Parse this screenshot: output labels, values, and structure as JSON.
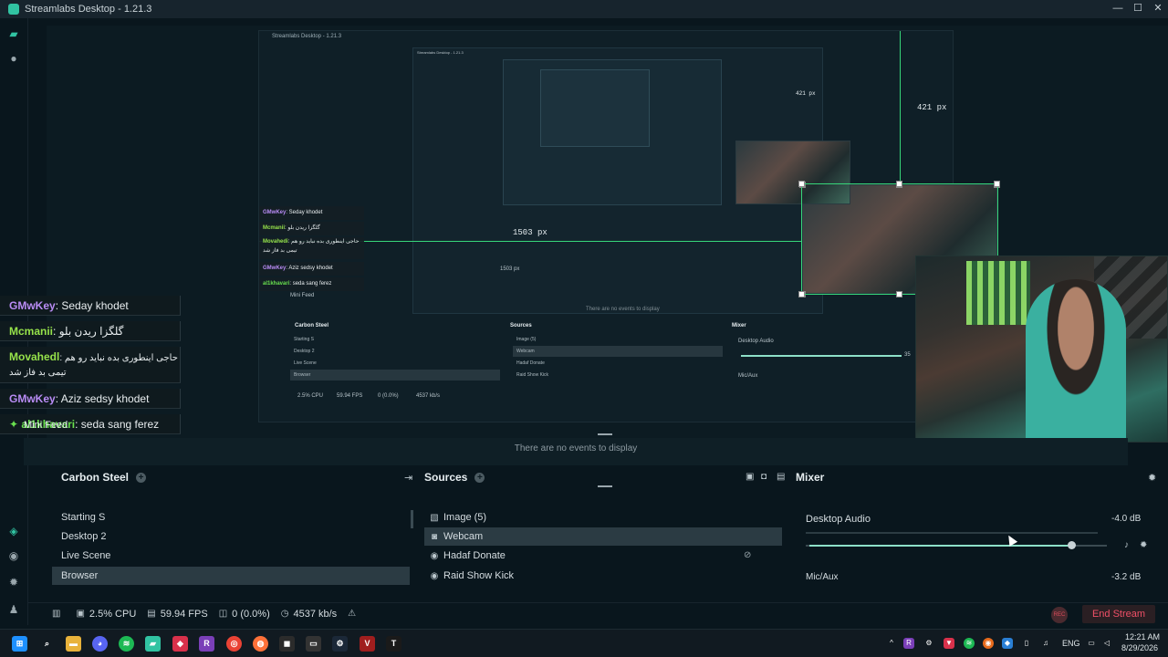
{
  "window": {
    "title": "Streamlabs Desktop - 1.21.3",
    "controls": [
      "—",
      "☐",
      "✕"
    ]
  },
  "nested_preview": {
    "title": "Streamlabs Desktop - 1.21.3",
    "title_inner": "Streamlabs Desktop - 1.21.3",
    "measure_width": "1503 px",
    "measure_height": "421 px",
    "measure_width_small": "1503 px",
    "measure_height_small": "421 px",
    "mini_feed": "Mini Feed",
    "empty": "There are no events to display",
    "scenes_title": "Carbon Steel",
    "scenes": [
      "Starting S",
      "Desktop 2",
      "Live Scene",
      "Browser"
    ],
    "sources_title": "Sources",
    "sources": [
      "Image (5)",
      "Webcam",
      "Hadaf Donate",
      "Raid Show Kick"
    ],
    "mixer_title": "Mixer",
    "mixer": [
      "Desktop Audio",
      "Mic/Aux"
    ],
    "volume_label": "35",
    "status": [
      "2.5% CPU",
      "59.94 FPS",
      "0 (0.0%)",
      "4537 kb/s"
    ],
    "chat": [
      {
        "user": "GMwKey",
        "text": ": Seday khodet",
        "color": "purple"
      },
      {
        "user": "Mcmanii",
        "text": ": گلگزا ریدن بلو",
        "color": "green"
      },
      {
        "user": "Movahedi",
        "text": ": حاجی اینطوری بده نباید رو هم تیمی بد فاز شد",
        "color": "green"
      },
      {
        "user": "GMwKey",
        "text": ": Aziz sedsy khodet",
        "color": "purple"
      },
      {
        "user": "al1khavari",
        "text": ": seda sang ferez",
        "color": "green2"
      }
    ]
  },
  "chat": {
    "messages": [
      {
        "user": "GMwKey",
        "text": ": Seday khodet",
        "color": "purple"
      },
      {
        "user": "Mcmanii",
        "text": ": گلگزا ریدن بلو",
        "color": "green"
      },
      {
        "user": "Movahedl",
        "text": ": حاجی اینطوری بده نباید رو هم",
        "text2": "تیمی بد فاز شد",
        "color": "green"
      },
      {
        "user": "GMwKey",
        "text": ": Aziz sedsy khodet",
        "color": "purple"
      },
      {
        "user": "al1khavari",
        "text": ": seda sang ferez",
        "color": "green2",
        "badge": "✦"
      }
    ]
  },
  "mini_feed": {
    "title": "Mini Feed",
    "empty_text": "There are no events to display"
  },
  "scenes": {
    "title": "Carbon Steel",
    "items": [
      "Starting S",
      "Desktop 2",
      "Live Scene",
      "Browser"
    ],
    "selected": "Browser"
  },
  "sources": {
    "title": "Sources",
    "items": [
      {
        "label": "Image (5)",
        "icon": "image-icon"
      },
      {
        "label": "Webcam",
        "icon": "webcam-icon"
      },
      {
        "label": "Hadaf Donate",
        "icon": "browser-source-icon"
      },
      {
        "label": "Raid Show Kick",
        "icon": "browser-source-icon"
      }
    ],
    "selected": "Webcam"
  },
  "mixer": {
    "title": "Mixer",
    "channels": [
      {
        "name": "Desktop Audio",
        "level": "-4.0 dB",
        "volume_fraction": 0.89
      },
      {
        "name": "Mic/Aux",
        "level": "-3.2 dB"
      }
    ]
  },
  "status": {
    "cpu": "2.5% CPU",
    "fps": "59.94 FPS",
    "dropped": "0 (0.0%)",
    "bitrate": "4537 kb/s",
    "rec_label": "REC",
    "end_stream": "End Stream"
  },
  "taskbar": {
    "lang": "ENG",
    "time": "12:21 AM",
    "date": "8/29/2026"
  },
  "colors": {
    "accent": "#31c3a2",
    "end_stream": "#ef5067",
    "guide": "#37d67a"
  }
}
